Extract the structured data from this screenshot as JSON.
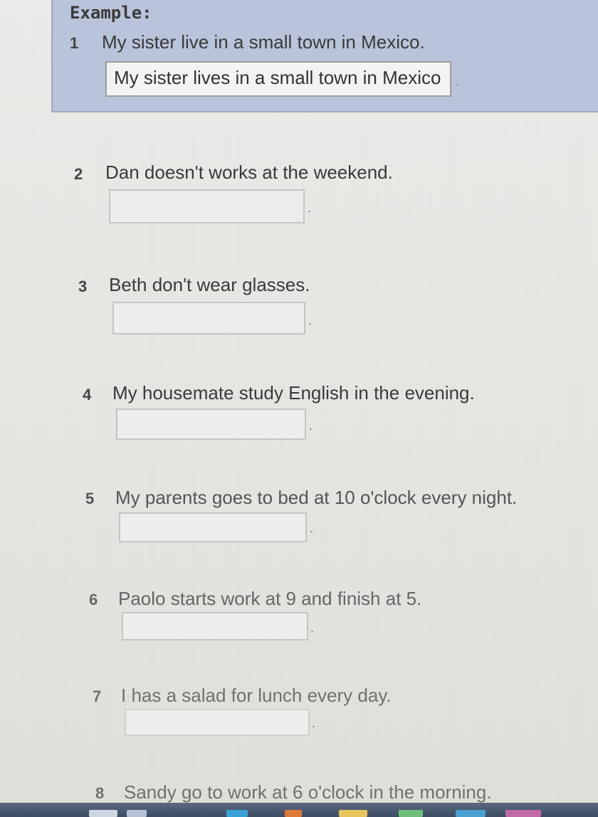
{
  "example": {
    "title": "Example:",
    "number": "1",
    "sentence": "My sister live in a small town in Mexico.",
    "answer": "My sister lives in a small town in Mexico",
    "period": "."
  },
  "items": [
    {
      "number": "2",
      "sentence": "Dan doesn't works at the weekend.",
      "period": "."
    },
    {
      "number": "3",
      "sentence": "Beth don't wear glasses.",
      "period": "."
    },
    {
      "number": "4",
      "sentence": "My housemate study English in the evening.",
      "period": "."
    },
    {
      "number": "5",
      "sentence": "My parents goes to bed at 10 o'clock every night.",
      "period": "."
    },
    {
      "number": "6",
      "sentence": "Paolo starts work at 9 and finish at 5.",
      "period": "."
    },
    {
      "number": "7",
      "sentence": "I has a salad for lunch every day.",
      "period": "."
    },
    {
      "number": "8",
      "sentence": "Sandy go to work at 6 o'clock in the morning.",
      "period": ""
    }
  ],
  "colors": {
    "example_bg": "#b9c3d9",
    "taskbar": "#3e4c63"
  }
}
